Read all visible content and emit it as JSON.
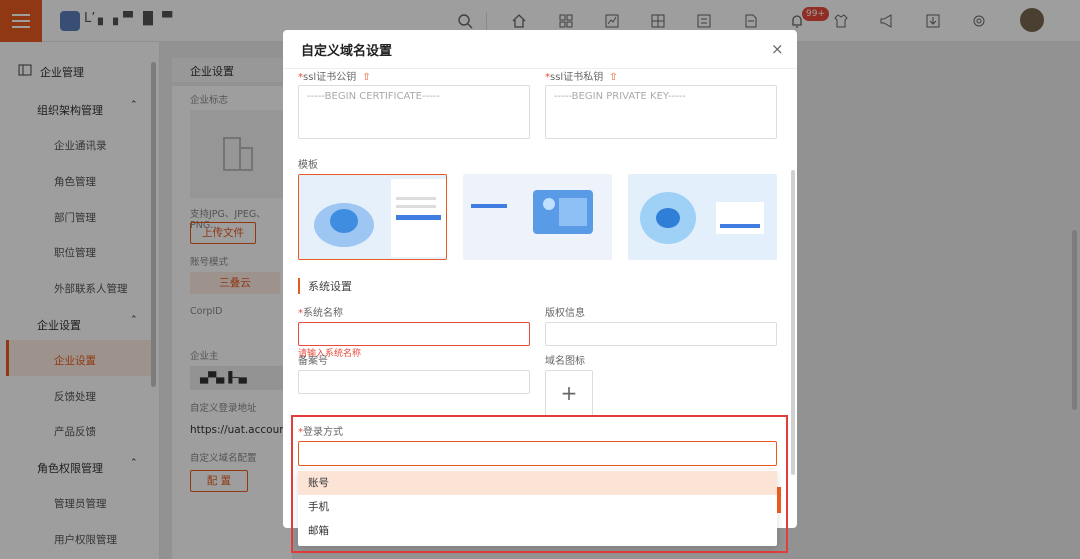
{
  "topbar": {
    "brand_text": "L’ ▖▗▝▘▐▌  ▀",
    "badge": "99+",
    "icons": [
      "search-icon",
      "home-icon",
      "grid-icon",
      "chart-icon",
      "apps-icon",
      "form-icon",
      "doc-icon",
      "bell-icon",
      "shirt-icon",
      "megaphone-icon",
      "download-icon",
      "settings-icon"
    ]
  },
  "sidebar": {
    "title": "企业管理",
    "groups": [
      {
        "label": "组织架构管理",
        "items": [
          "企业通讯录",
          "角色管理",
          "部门管理",
          "职位管理",
          "外部联系人管理"
        ]
      },
      {
        "label": "企业设置",
        "items": [
          "企业设置",
          "反馈处理",
          "产品反馈"
        ]
      },
      {
        "label": "角色权限管理",
        "items": [
          "管理员管理",
          "用户权限管理"
        ]
      }
    ]
  },
  "background": {
    "tab": "企业设置",
    "logo_label": "企业标志",
    "formats": "支持JPG、JPEG、PNG...",
    "upload_btn": "上传文件",
    "account_mode_label": "账号模式",
    "account_mode_value": "三叠云",
    "corp_label": "CorpID",
    "corp_value": "",
    "owner_label": "企业主",
    "owner_value": "▄▀▄▐─▄",
    "login_url_label": "自定义登录地址",
    "login_url_value": "https://uat.accoun",
    "domain_label": "自定义域名配置",
    "config_btn": "配 置"
  },
  "dialog": {
    "title": "自定义域名设置",
    "close": "×",
    "ssl_pub_label": "ssl证书公钥",
    "ssl_pub_placeholder": "-----BEGIN CERTIFICATE-----",
    "ssl_priv_label": "ssl证书私钥",
    "ssl_priv_placeholder": "-----BEGIN PRIVATE KEY-----",
    "template_label": "模板",
    "section_title": "系统设置",
    "sys_name_label": "系统名称",
    "sys_name_error": "请输入系统名称",
    "copyright_label": "版权信息",
    "record_label": "备案号",
    "domain_icon_label": "域名图标",
    "plus": "+",
    "login_label": "登录方式",
    "login_options": [
      "账号",
      "手机",
      "邮箱"
    ]
  },
  "colors": {
    "accent": "#e85a20",
    "error": "#e84b3c"
  }
}
